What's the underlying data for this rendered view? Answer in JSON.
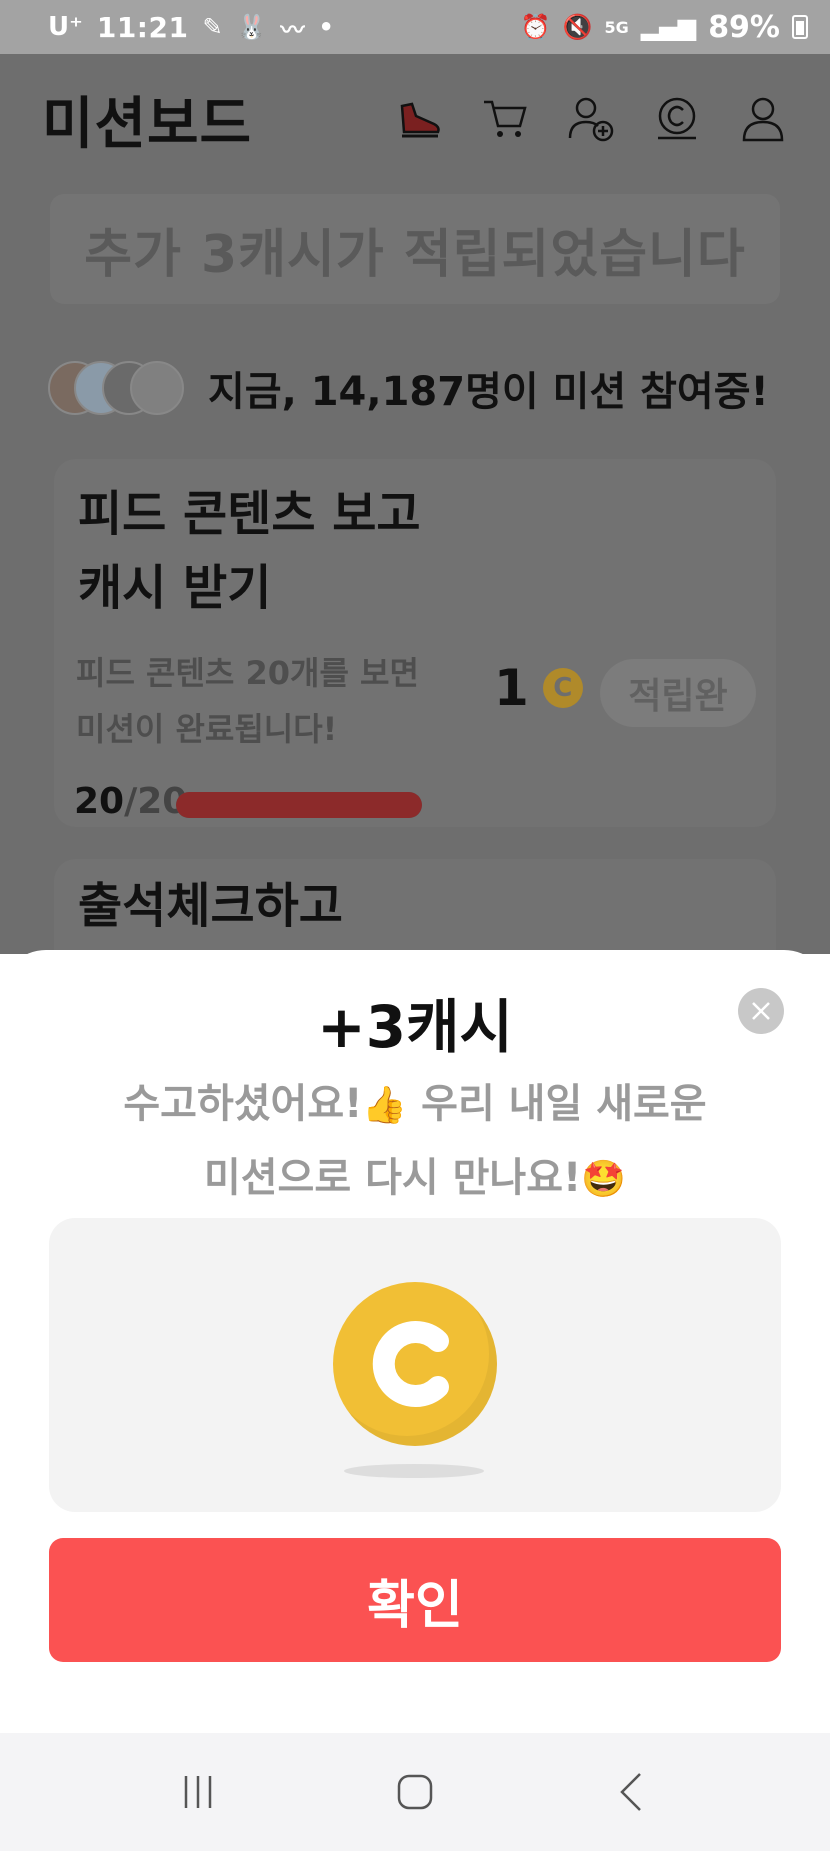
{
  "status_bar": {
    "carrier": "U⁺",
    "time": "11:21",
    "battery": "89%",
    "network": "5G",
    "icons": [
      "notification-icon",
      "bunny-icon",
      "mustache-icon",
      "alarm-icon",
      "mute-icon",
      "signal-icon",
      "battery-icon"
    ]
  },
  "app": {
    "title": "미션보드",
    "header_icons": [
      "sneaker-icon",
      "cart-icon",
      "add-friend-icon",
      "cash-coin-icon",
      "profile-icon"
    ],
    "banner": "추가 3캐시가 적립되었습니다",
    "participants_text": "지금, 14,187명이 미션 참여중!",
    "missions": [
      {
        "title_line1": "피드 콘텐츠 보고",
        "title_line2": "캐시 받기",
        "desc_line1": "피드 콘텐츠 20개를 보면",
        "desc_line2": "미션이 완료됩니다!",
        "progress_current": "20",
        "progress_total": "/20",
        "progress_fraction": 1.0,
        "reward": "1",
        "status": "적립완"
      },
      {
        "title_line1": "출석체크하고"
      }
    ]
  },
  "sheet": {
    "title": "+3캐시",
    "message_line1": "수고하셨어요!",
    "message_emoji1": "👍",
    "message_line1b": " 우리 내일 새로운",
    "message_line2": "미션으로 다시 만나요!",
    "message_emoji2": "🤩",
    "confirm_label": "확인"
  },
  "colors": {
    "accent": "#fb5252",
    "coin": "#f1bf35",
    "dim_overlay": "#6e6e6e"
  }
}
